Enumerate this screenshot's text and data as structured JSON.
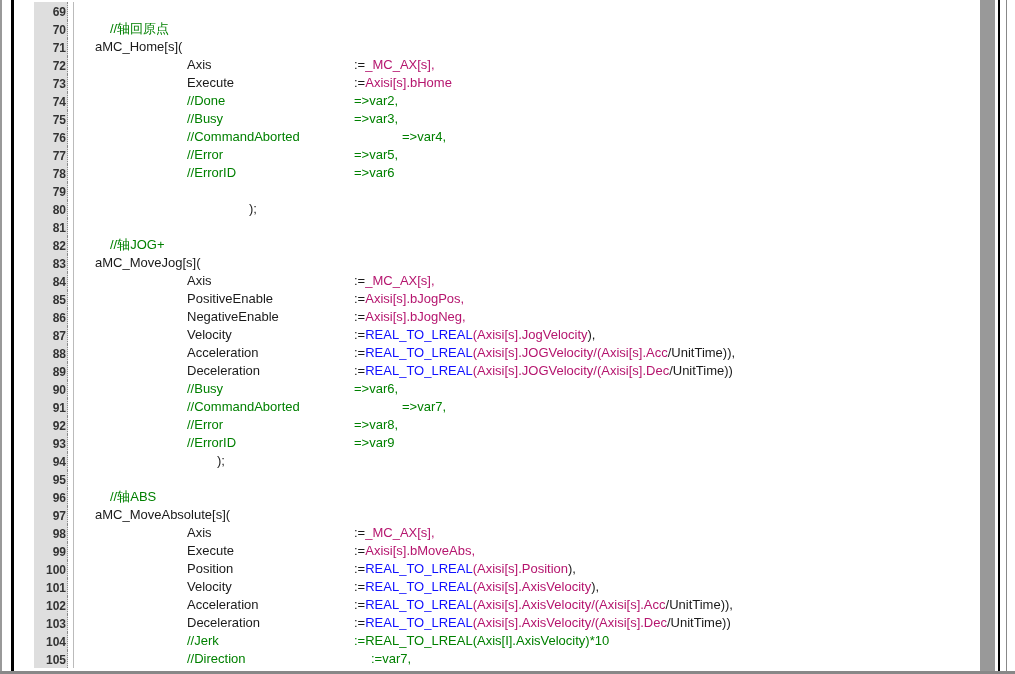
{
  "editor": {
    "lines": [
      {
        "number": "69",
        "kind": "blank"
      },
      {
        "number": "70",
        "kind": "comment",
        "code": [
          {
            "text": "//轴回原点",
            "kind": "comment"
          }
        ]
      },
      {
        "number": "71",
        "kind": "call",
        "code": [
          {
            "text": "aMC_Home[s](",
            "kind": "plain"
          }
        ]
      },
      {
        "number": "72",
        "kind": "param",
        "code": [
          {
            "text": "Axis",
            "kind": "plain"
          }
        ],
        "value": [
          {
            "text": ":=",
            "kind": "plain"
          },
          {
            "text": "_MC_AX[s],",
            "kind": "variable"
          }
        ]
      },
      {
        "number": "73",
        "kind": "param",
        "code": [
          {
            "text": "Execute",
            "kind": "plain"
          }
        ],
        "value": [
          {
            "text": ":=",
            "kind": "plain"
          },
          {
            "text": "Axisi[s].bHome",
            "kind": "variable"
          }
        ]
      },
      {
        "number": "74",
        "kind": "param",
        "code": [
          {
            "text": "//Done",
            "kind": "comment"
          }
        ],
        "value": [
          {
            "text": "=>var2,",
            "kind": "comment"
          }
        ]
      },
      {
        "number": "75",
        "kind": "param",
        "code": [
          {
            "text": "//Busy",
            "kind": "comment"
          }
        ],
        "value": [
          {
            "text": "=>var3,",
            "kind": "comment"
          }
        ]
      },
      {
        "number": "76",
        "kind": "param_far",
        "code": [
          {
            "text": "//CommandAborted",
            "kind": "comment"
          }
        ],
        "value": [
          {
            "text": "=>var4,",
            "kind": "comment"
          }
        ]
      },
      {
        "number": "77",
        "kind": "param",
        "code": [
          {
            "text": "//Error",
            "kind": "comment"
          }
        ],
        "value": [
          {
            "text": "=>var5,",
            "kind": "comment"
          }
        ]
      },
      {
        "number": "78",
        "kind": "param",
        "code": [
          {
            "text": "//ErrorID",
            "kind": "comment"
          }
        ],
        "value": [
          {
            "text": "=>var6",
            "kind": "comment"
          }
        ]
      },
      {
        "number": "79",
        "kind": "blank"
      },
      {
        "number": "80",
        "kind": "close",
        "code": [
          {
            "text": ");",
            "kind": "plain"
          }
        ]
      },
      {
        "number": "81",
        "kind": "blank"
      },
      {
        "number": "82",
        "kind": "comment",
        "code": [
          {
            "text": "//轴JOG+",
            "kind": "comment"
          }
        ]
      },
      {
        "number": "83",
        "kind": "call",
        "code": [
          {
            "text": "aMC_MoveJog[s](",
            "kind": "plain"
          }
        ]
      },
      {
        "number": "84",
        "kind": "param",
        "code": [
          {
            "text": "Axis",
            "kind": "plain"
          }
        ],
        "value": [
          {
            "text": ":=",
            "kind": "plain"
          },
          {
            "text": "_MC_AX[s],",
            "kind": "variable"
          }
        ]
      },
      {
        "number": "85",
        "kind": "param",
        "code": [
          {
            "text": "PositiveEnable",
            "kind": "plain"
          }
        ],
        "value": [
          {
            "text": ":=",
            "kind": "plain"
          },
          {
            "text": "Axisi[s].bJogPos,",
            "kind": "variable"
          }
        ]
      },
      {
        "number": "86",
        "kind": "param",
        "code": [
          {
            "text": "NegativeEnable",
            "kind": "plain"
          }
        ],
        "value": [
          {
            "text": ":=",
            "kind": "plain"
          },
          {
            "text": "Axisi[s].bJogNeg,",
            "kind": "variable"
          }
        ]
      },
      {
        "number": "87",
        "kind": "param",
        "code": [
          {
            "text": "Velocity",
            "kind": "plain"
          }
        ],
        "value": [
          {
            "text": ":=",
            "kind": "plain"
          },
          {
            "text": "REAL_TO_LREAL",
            "kind": "function"
          },
          {
            "text": "(Axisi[s].JogVelocity",
            "kind": "variable"
          },
          {
            "text": "),",
            "kind": "plain"
          }
        ]
      },
      {
        "number": "88",
        "kind": "param",
        "code": [
          {
            "text": "Acceleration",
            "kind": "plain"
          }
        ],
        "value": [
          {
            "text": ":=",
            "kind": "plain"
          },
          {
            "text": "REAL_TO_LREAL",
            "kind": "function"
          },
          {
            "text": "(Axisi[s].JOGVelocity/(Axisi[s].Acc",
            "kind": "variable"
          },
          {
            "text": "/UnitTime)),",
            "kind": "plain"
          }
        ]
      },
      {
        "number": "89",
        "kind": "param",
        "code": [
          {
            "text": "Deceleration",
            "kind": "plain"
          }
        ],
        "value": [
          {
            "text": ":=",
            "kind": "plain"
          },
          {
            "text": "REAL_TO_LREAL",
            "kind": "function"
          },
          {
            "text": "(Axisi[s].JOGVelocity/(Axisi[s].Dec",
            "kind": "variable"
          },
          {
            "text": "/UnitTime))",
            "kind": "plain"
          }
        ]
      },
      {
        "number": "90",
        "kind": "param",
        "code": [
          {
            "text": "//Busy",
            "kind": "comment"
          }
        ],
        "value": [
          {
            "text": "=>var6,",
            "kind": "comment"
          }
        ]
      },
      {
        "number": "91",
        "kind": "param_far",
        "code": [
          {
            "text": "//CommandAborted",
            "kind": "comment"
          }
        ],
        "value": [
          {
            "text": "=>var7,",
            "kind": "comment"
          }
        ]
      },
      {
        "number": "92",
        "kind": "param",
        "code": [
          {
            "text": "//Error",
            "kind": "comment"
          }
        ],
        "value": [
          {
            "text": "=>var8,",
            "kind": "comment"
          }
        ]
      },
      {
        "number": "93",
        "kind": "param",
        "code": [
          {
            "text": "//ErrorID",
            "kind": "comment"
          }
        ],
        "value": [
          {
            "text": "=>var9",
            "kind": "comment"
          }
        ]
      },
      {
        "number": "94",
        "kind": "close_inner",
        "code": [
          {
            "text": ");",
            "kind": "plain"
          }
        ]
      },
      {
        "number": "95",
        "kind": "blank"
      },
      {
        "number": "96",
        "kind": "comment",
        "code": [
          {
            "text": "//轴ABS",
            "kind": "comment"
          }
        ]
      },
      {
        "number": "97",
        "kind": "call",
        "code": [
          {
            "text": "aMC_MoveAbsolute[s](",
            "kind": "plain"
          }
        ]
      },
      {
        "number": "98",
        "kind": "param",
        "code": [
          {
            "text": "Axis",
            "kind": "plain"
          }
        ],
        "value": [
          {
            "text": ":=",
            "kind": "plain"
          },
          {
            "text": "_MC_AX[s],",
            "kind": "variable"
          }
        ]
      },
      {
        "number": "99",
        "kind": "param",
        "code": [
          {
            "text": "Execute",
            "kind": "plain"
          }
        ],
        "value": [
          {
            "text": ":=",
            "kind": "plain"
          },
          {
            "text": "Axisi[s].bMoveAbs,",
            "kind": "variable"
          }
        ]
      },
      {
        "number": "100",
        "kind": "param",
        "code": [
          {
            "text": "Position",
            "kind": "plain"
          }
        ],
        "value": [
          {
            "text": ":=",
            "kind": "plain"
          },
          {
            "text": "REAL_TO_LREAL",
            "kind": "function"
          },
          {
            "text": "(Axisi[s].Position",
            "kind": "variable"
          },
          {
            "text": "),",
            "kind": "plain"
          }
        ]
      },
      {
        "number": "101",
        "kind": "param",
        "code": [
          {
            "text": "Velocity",
            "kind": "plain"
          }
        ],
        "value": [
          {
            "text": ":=",
            "kind": "plain"
          },
          {
            "text": "REAL_TO_LREAL",
            "kind": "function"
          },
          {
            "text": "(Axisi[s].AxisVelocity",
            "kind": "variable"
          },
          {
            "text": "),",
            "kind": "plain"
          }
        ]
      },
      {
        "number": "102",
        "kind": "param",
        "code": [
          {
            "text": "Acceleration",
            "kind": "plain"
          }
        ],
        "value": [
          {
            "text": ":=",
            "kind": "plain"
          },
          {
            "text": "REAL_TO_LREAL",
            "kind": "function"
          },
          {
            "text": "(Axisi[s].AxisVelocity/(Axisi[s].Acc",
            "kind": "variable"
          },
          {
            "text": "/UnitTime)),",
            "kind": "plain"
          }
        ]
      },
      {
        "number": "103",
        "kind": "param",
        "code": [
          {
            "text": "Deceleration",
            "kind": "plain"
          }
        ],
        "value": [
          {
            "text": ":=",
            "kind": "plain"
          },
          {
            "text": "REAL_TO_LREAL",
            "kind": "function"
          },
          {
            "text": "(Axisi[s].AxisVelocity/(Axisi[s].Dec",
            "kind": "variable"
          },
          {
            "text": "/UnitTime))",
            "kind": "plain"
          }
        ]
      },
      {
        "number": "104",
        "kind": "param",
        "code": [
          {
            "text": "//Jerk",
            "kind": "comment"
          }
        ],
        "value": [
          {
            "text": ":=REAL_TO_LREAL(Axis[I].AxisVelocity)*10",
            "kind": "comment"
          }
        ]
      },
      {
        "number": "105",
        "kind": "param_near",
        "code": [
          {
            "text": "//Direction",
            "kind": "comment"
          }
        ],
        "value": [
          {
            "text": ":=var7,",
            "kind": "comment"
          }
        ]
      }
    ]
  }
}
